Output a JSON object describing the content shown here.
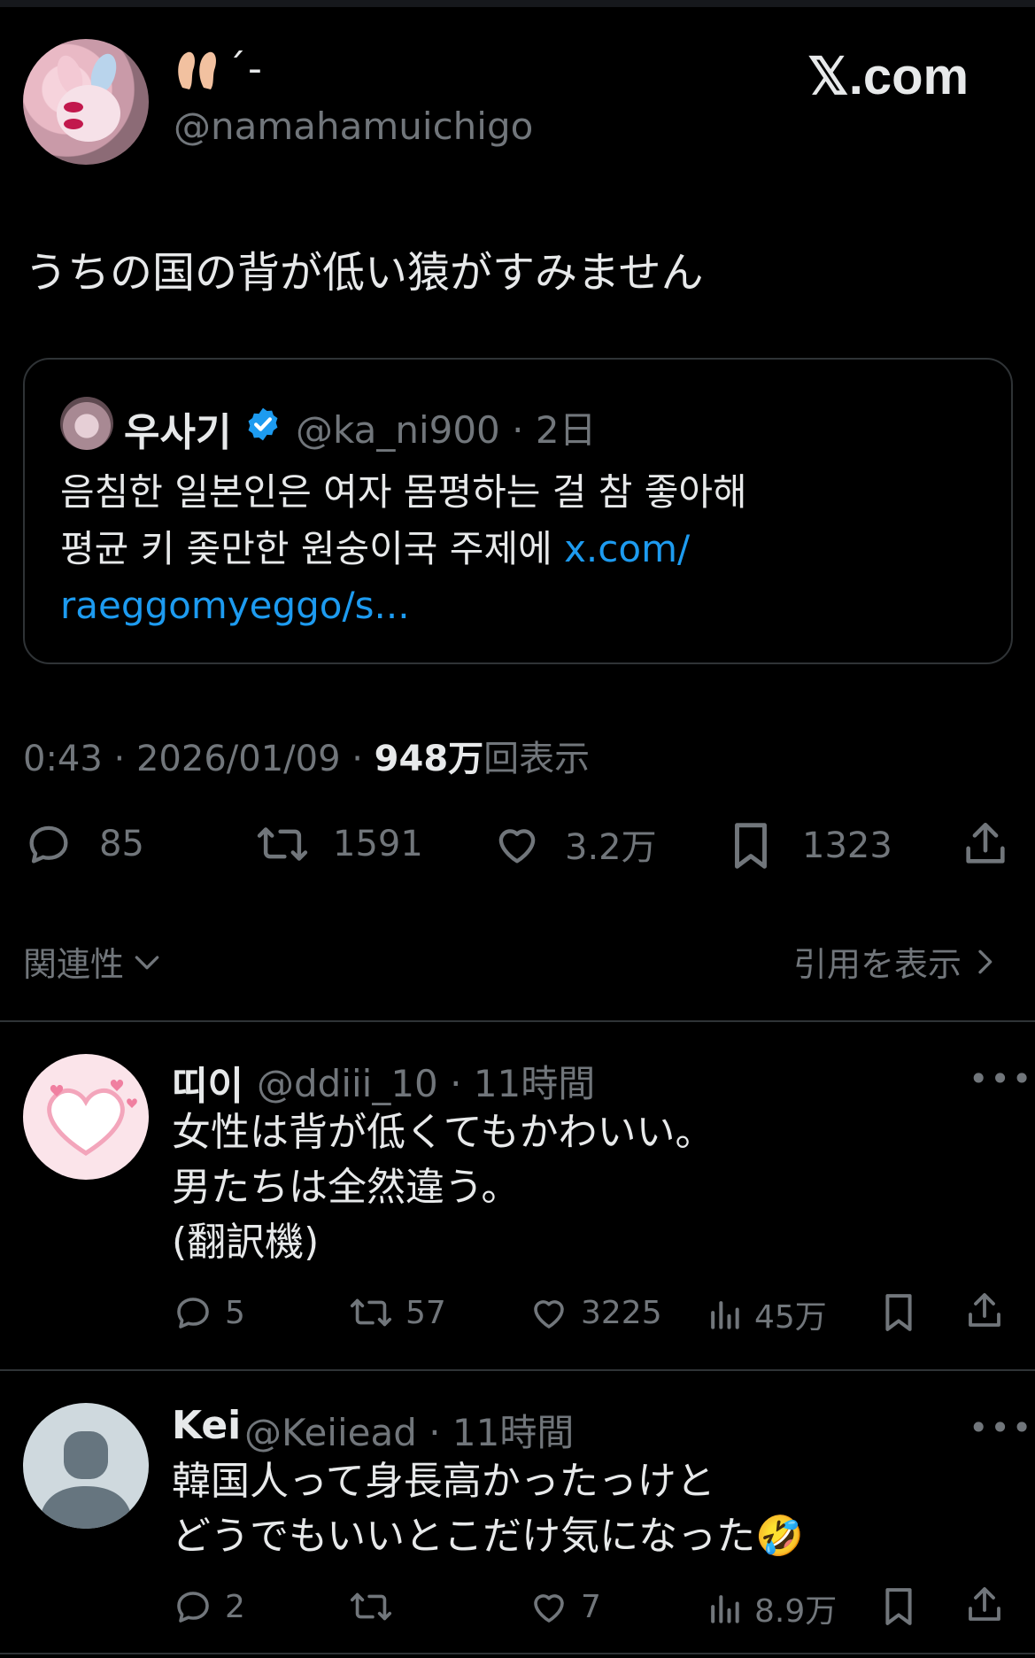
{
  "author": {
    "name_suffix": "´-",
    "handle": "@namahamuichigo"
  },
  "brand": {
    "logo_text": "𝕏.com"
  },
  "tweet": {
    "text": "うちの国の背が低い猿がすみません"
  },
  "quote": {
    "name": "우사기",
    "handle_time": "@ka_ni900 · 2日",
    "line1": "음침한 일본인은 여자 몸평하는 걸 참 좋아해",
    "line2": "평균 키 좆만한 원숭이국 주제에 ",
    "link_part1": "x.com/",
    "link_part2": "raeggomyeggo/s..."
  },
  "meta": {
    "time_date": "0:43 · 2026/01/09 · ",
    "views_count": "948万",
    "views_label": "回表示"
  },
  "actions": {
    "replies": "85",
    "reposts": "1591",
    "likes": "3.2万",
    "bookmarks": "1323"
  },
  "sort": {
    "relevance_label": "関連性",
    "quotes_label": "引用を表示"
  },
  "replies": [
    {
      "name": "띠이",
      "handle_time": "@ddiii_10 · 11時間",
      "lines": [
        "女性は背が低くてもかわいい。",
        "男たちは全然違う。",
        "(翻訳機)"
      ],
      "replies": "5",
      "reposts": "57",
      "likes": "3225",
      "views": "45万"
    },
    {
      "name": "Kei",
      "handle_time": "@Keiiead · 11時間",
      "lines": [
        "韓国人って身長高かったっけと",
        "どうでもいいとこだけ気になった🤣"
      ],
      "replies": "2",
      "reposts": "",
      "likes": "7",
      "views": "8.9万"
    }
  ],
  "more_label": "•••",
  "colors": {
    "accent": "#1d9bf0",
    "muted": "#71767b",
    "text": "#e7e9ea",
    "border": "#2f3336"
  }
}
